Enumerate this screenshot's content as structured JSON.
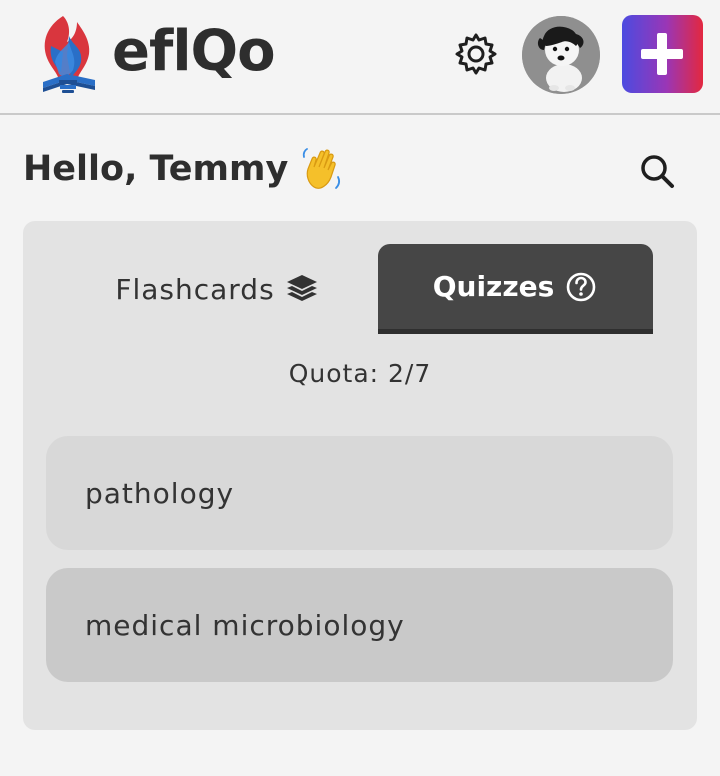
{
  "app": {
    "name": "eflQo"
  },
  "header": {
    "icons": [
      "logo-icon",
      "gear-icon",
      "avatar-dog-icon",
      "plus-icon"
    ],
    "add_button_gradient": [
      "#4c4be0",
      "#9a36b6",
      "#e3283f"
    ]
  },
  "greeting": {
    "text": "Hello, Temmy",
    "emoji": "👋"
  },
  "tabs": [
    {
      "label": "Flashcards",
      "icon": "layers-icon",
      "active": false
    },
    {
      "label": "Quizzes",
      "icon": "help-circle-icon",
      "active": true
    }
  ],
  "quota": {
    "text": "Quota: 2/7"
  },
  "topics": [
    {
      "label": "pathology"
    },
    {
      "label": "medical microbiology"
    }
  ],
  "colors": {
    "active_tab_bg": "#464646",
    "card_bg": "#e3e3e3",
    "page_bg": "#f4f4f4"
  }
}
